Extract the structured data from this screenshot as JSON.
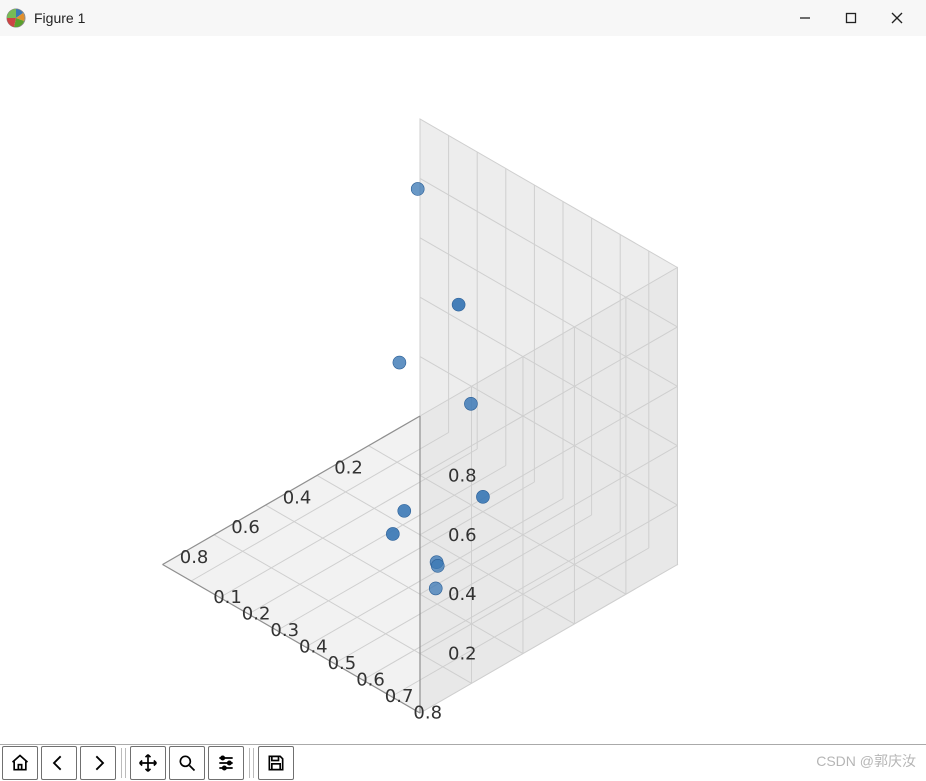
{
  "window": {
    "title": "Figure 1"
  },
  "toolbar": {
    "home": "Home",
    "back": "Back",
    "forward": "Forward",
    "pan": "Pan",
    "zoom": "Zoom",
    "config": "Configure subplots",
    "save": "Save"
  },
  "watermark": "CSDN @郭庆汝",
  "chart_data": {
    "type": "scatter",
    "title": "",
    "projection": "3d",
    "x_ticks": [
      0.2,
      0.4,
      0.6,
      0.8
    ],
    "y_ticks": [
      0.1,
      0.2,
      0.3,
      0.4,
      0.5,
      0.6,
      0.7,
      0.8
    ],
    "z_ticks": [
      0.2,
      0.4,
      0.6,
      0.8
    ],
    "xlim": [
      0.0,
      1.0
    ],
    "ylim": [
      0.0,
      0.9
    ],
    "zlim": [
      0.0,
      1.0
    ],
    "points": [
      {
        "x": 0.12,
        "y": 0.1,
        "z": 0.88
      },
      {
        "x": 0.08,
        "y": 0.25,
        "z": 0.22
      },
      {
        "x": 0.2,
        "y": 0.4,
        "z": 0.05
      },
      {
        "x": 0.28,
        "y": 0.18,
        "z": 0.42
      },
      {
        "x": 0.35,
        "y": 0.45,
        "z": 0.8
      },
      {
        "x": 0.45,
        "y": 0.35,
        "z": 0.1
      },
      {
        "x": 0.55,
        "y": 0.4,
        "z": 0.1
      },
      {
        "x": 0.78,
        "y": 0.76,
        "z": 0.32
      },
      {
        "x": 0.82,
        "y": 0.8,
        "z": 0.35
      },
      {
        "x": 0.85,
        "y": 0.82,
        "z": 0.3
      }
    ],
    "color": "#3b78b5"
  }
}
